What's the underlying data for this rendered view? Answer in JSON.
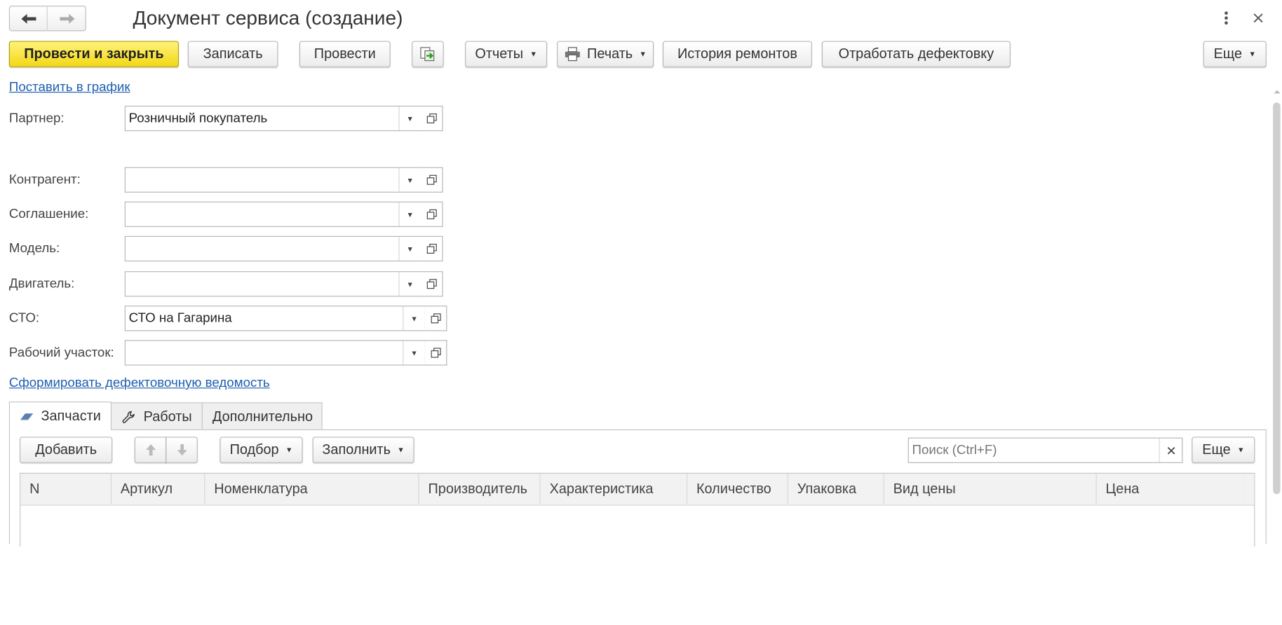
{
  "window": {
    "title": "Документ сервиса (создание)"
  },
  "toolbar": {
    "post_close": "Провести и закрыть",
    "save": "Записать",
    "post": "Провести",
    "reports": "Отчеты",
    "print": "Печать",
    "repair_history": "История ремонтов",
    "process_defects": "Отработать дефектовку",
    "more": "Еще"
  },
  "links": {
    "schedule": "Поставить в график",
    "defect_sheet": "Сформировать дефектовочную ведомость"
  },
  "form": {
    "partner_label": "Партнер:",
    "partner_value": "Розничный покупатель",
    "counterparty_label": "Контрагент:",
    "counterparty_value": "",
    "agreement_label": "Соглашение:",
    "agreement_value": "",
    "model_label": "Модель:",
    "model_value": "",
    "engine_label": "Двигатель:",
    "engine_value": "",
    "sto_label": "СТО:",
    "sto_value": "СТО на Гагарина",
    "workarea_label": "Рабочий участок:",
    "workarea_value": ""
  },
  "tabs": [
    {
      "label": "Запчасти",
      "active": true
    },
    {
      "label": "Работы",
      "active": false
    },
    {
      "label": "Дополнительно",
      "active": false
    }
  ],
  "table_toolbar": {
    "add": "Добавить",
    "selection": "Подбор",
    "fill": "Заполнить",
    "search_placeholder": "Поиск (Ctrl+F)",
    "more": "Еще"
  },
  "table": {
    "columns": [
      "N",
      "Артикул",
      "Номенклатура",
      "Производитель",
      "Характеристика",
      "Количество",
      "Упаковка",
      "Вид цены",
      "Цена"
    ]
  },
  "colors": {
    "primary_button": "#f3d815",
    "link": "#1f5fb0"
  }
}
